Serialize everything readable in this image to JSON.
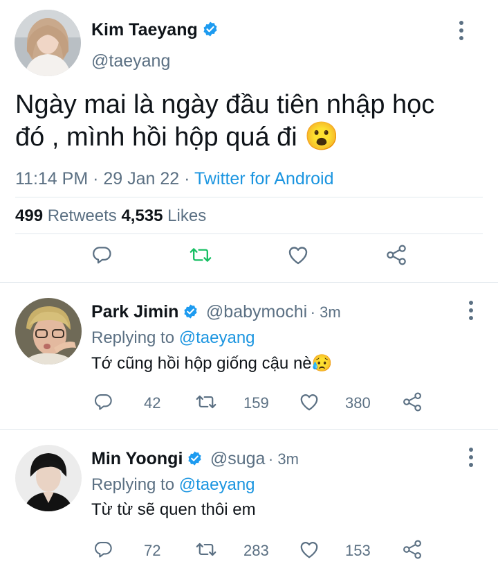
{
  "tweet": {
    "author_name": "Kim Taeyang",
    "handle": "@taeyang",
    "text_line1": "Ngày mai là ngày đầu tiên nhập học",
    "text_line2": "đó , mình hồi hộp quá đi",
    "emoji": "😮",
    "time": "11:14 PM",
    "sep": "·",
    "date": "29 Jan 22",
    "client": "Twitter for Android",
    "retweets_count": "499",
    "retweets_label": "Retweets",
    "likes_count": "4,535",
    "likes_label": "Likes"
  },
  "replies": [
    {
      "author_name": "Park Jimin",
      "handle": "@babymochi",
      "time": "· 3m",
      "replying_label": "Replying to",
      "replying_handle": "@taeyang",
      "text": "Tớ cũng hồi hộp giống cậu nè",
      "emoji": "😥",
      "reply_count": "42",
      "retweet_count": "159",
      "like_count": "380"
    },
    {
      "author_name": "Min Yoongi",
      "handle": "@suga",
      "time": "· 3m",
      "replying_label": "Replying to",
      "replying_handle": "@taeyang",
      "text": "Từ từ sẽ quen thôi em",
      "reply_count": "72",
      "retweet_count": "283",
      "like_count": "153"
    }
  ],
  "colors": {
    "text": "#0f1419",
    "secondary": "#5b7083",
    "link": "#1b95e0",
    "retweet_green": "#17bf63",
    "divider": "#e1e8ed"
  },
  "icons": [
    "verified-badge-icon",
    "more-options-icon",
    "reply-icon",
    "retweet-icon",
    "like-icon",
    "share-icon"
  ]
}
